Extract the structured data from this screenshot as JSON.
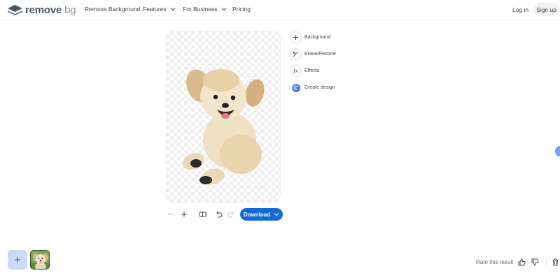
{
  "header": {
    "logo_bold": "remove",
    "logo_thin": "bg",
    "nav": [
      {
        "label": "Remove Background",
        "has_dropdown": false
      },
      {
        "label": "Features",
        "has_dropdown": true
      },
      {
        "label": "For Business",
        "has_dropdown": true
      },
      {
        "label": "Pricing",
        "has_dropdown": false
      }
    ],
    "login_label": "Log in",
    "signup_label": "Sign up"
  },
  "tools": [
    {
      "label": "Background",
      "icon": "plus-icon"
    },
    {
      "label": "Erase/Restore",
      "icon": "brush-icon"
    },
    {
      "label": "Effects",
      "icon": "fx-icon"
    },
    {
      "label": "Create design",
      "icon": "canva-icon"
    }
  ],
  "toolbar": {
    "zoom_out_icon": "minus-icon",
    "zoom_in_icon": "plus-icon",
    "compare_icon": "compare-icon",
    "undo_icon": "undo-icon",
    "redo_icon": "redo-icon",
    "download_label": "Download"
  },
  "footer": {
    "add_icon": "plus-icon",
    "rate_label": "Rate this result"
  },
  "colors": {
    "accent": "#1568d6",
    "add_tile_bg": "#c9dbf5"
  }
}
